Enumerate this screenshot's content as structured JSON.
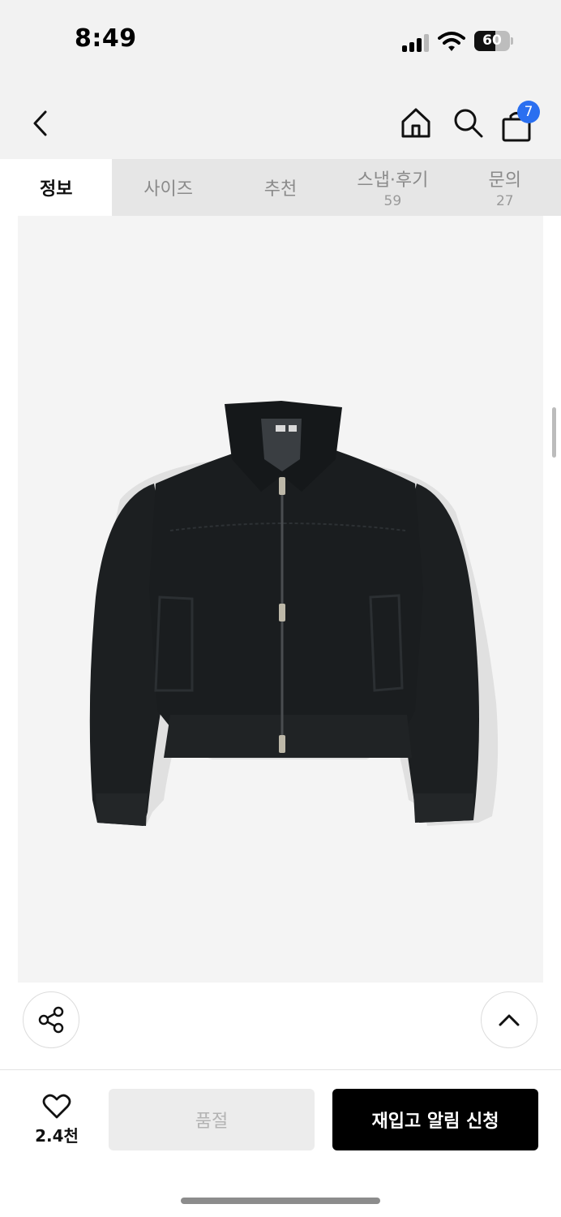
{
  "status_bar": {
    "time": "8:49",
    "battery": "60",
    "battery_level_percent": 60
  },
  "nav": {
    "back_icon": "chevron-left-icon",
    "home_icon": "home-icon",
    "search_icon": "search-icon",
    "cart_icon": "shopping-bag-icon",
    "cart_count": "7",
    "badge_color": "#2a6ff0"
  },
  "tabs": [
    {
      "label": "정보",
      "count": ""
    },
    {
      "label": "사이즈",
      "count": ""
    },
    {
      "label": "추천",
      "count": ""
    },
    {
      "label": "스냅·후기",
      "count": "59"
    },
    {
      "label": "문의",
      "count": "27"
    }
  ],
  "product_image": {
    "icon": "black-zip-jacket-image"
  },
  "floating": {
    "share_icon": "share-icon",
    "top_icon": "chevron-up-icon"
  },
  "bottom_bar": {
    "like_icon": "heart-icon",
    "like_count": "2.4천",
    "soldout_label": "품절",
    "restock_label": "재입고 알림 신청"
  }
}
